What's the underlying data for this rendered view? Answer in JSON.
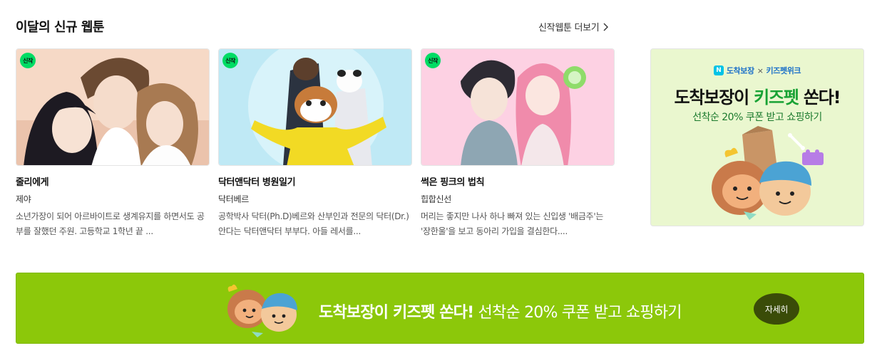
{
  "section": {
    "title": "이달의 신규 웹툰",
    "more_label": "신작웹툰 더보기"
  },
  "cards": [
    {
      "badge": "신작",
      "title": "줄리에게",
      "author": "제야",
      "description": "소년가장이 되어 아르바이트로 생계유지를 하면서도 공부를 잘했던 주원. 고등학교 1학년 끝 ..."
    },
    {
      "badge": "신작",
      "title": "닥터앤닥터 병원일기",
      "author": "닥터베르",
      "description": "공학박사 닥터(Ph.D)베르와 산부인과 전문의 닥터(Dr.)안다는 닥터앤닥터 부부다. 아들 레서를..."
    },
    {
      "badge": "신작",
      "title": "썩은 핑크의 법칙",
      "author": "힙합신선",
      "description": "머리는 좋지만 나사 하나 빠져 있는 신입생 '배금주'는 '장한울'을 보고 동아리 가입을 결심한다...."
    }
  ],
  "side_ad": {
    "brand_left": "도착보장",
    "brand_sep": "×",
    "brand_right": "키즈펫위크",
    "headline_main": "도착보장이",
    "headline_highlight": "키즈펫",
    "headline_end": "쏜다!",
    "subline": "선착순 20% 쿠폰 받고 쇼핑하기"
  },
  "banner": {
    "headline_bold": "도착보장이 키즈펫 쏜다!",
    "headline_rest": " 선착순 20% 쿠폰 받고 쇼핑하기",
    "detail_label": "자세히"
  },
  "colors": {
    "badge_green": "#00dc64",
    "banner_green": "#8cc80a",
    "detail_button": "#3a4c08",
    "ad_highlight": "#18a234"
  }
}
